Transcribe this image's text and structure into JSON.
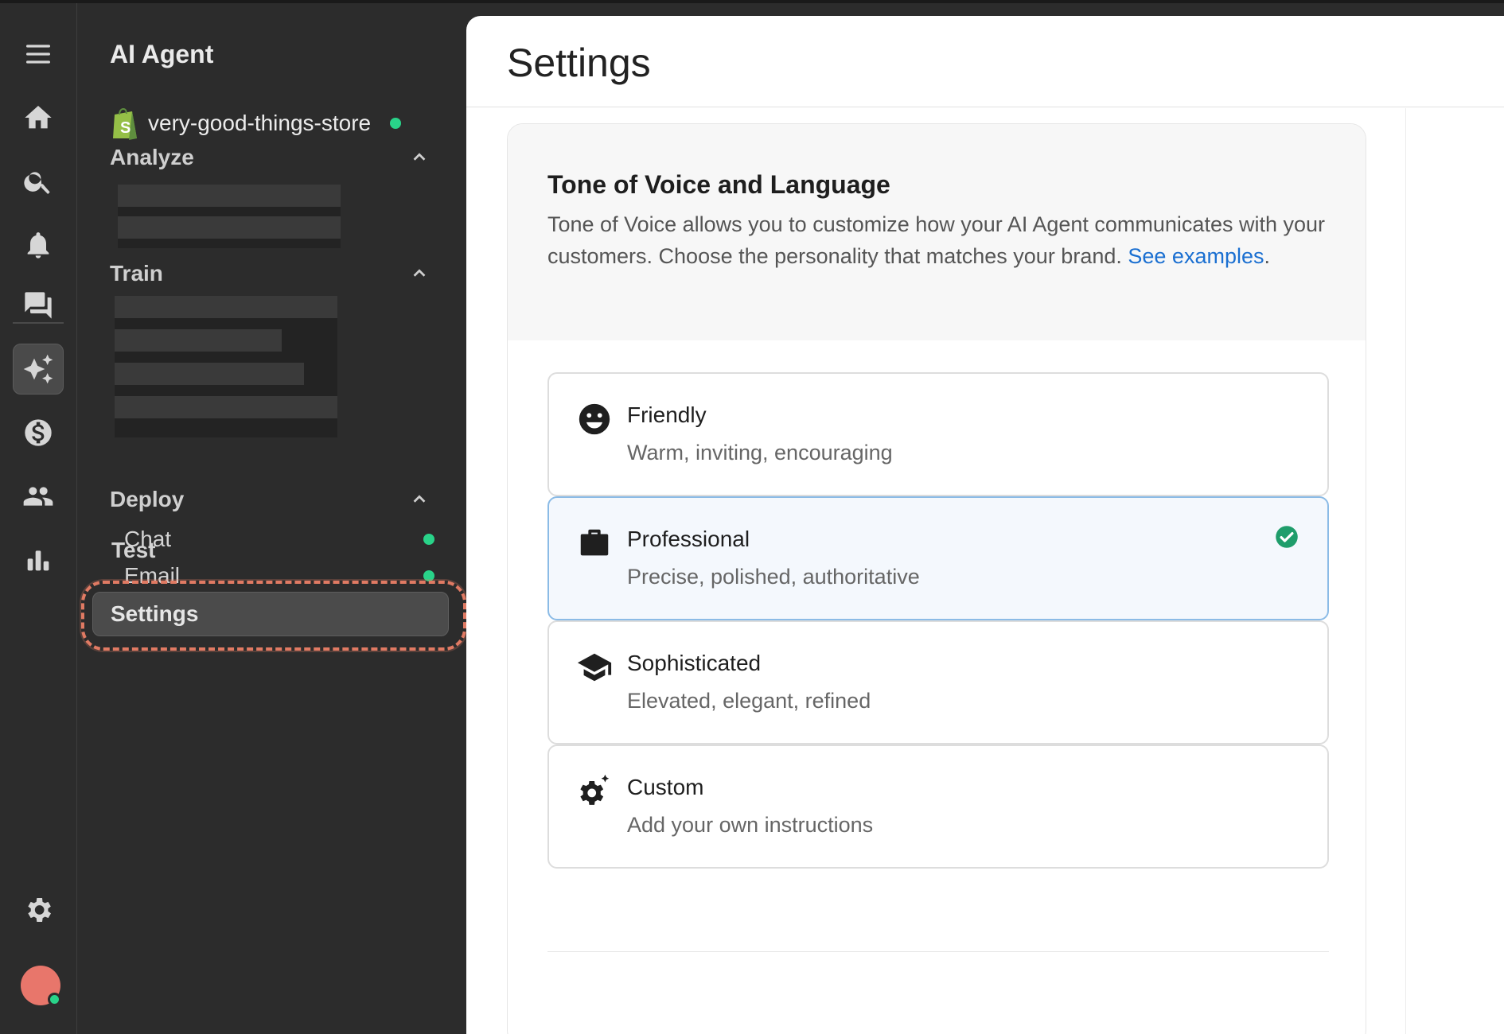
{
  "app": {
    "title": "AI Agent"
  },
  "store": {
    "name": "very-good-things-store",
    "status_color": "#29d389"
  },
  "rail": {
    "icons": [
      "menu-icon",
      "home-icon",
      "search-icon",
      "bell-icon",
      "chat-bubbles-icon",
      "sparkles-icon",
      "dollar-icon",
      "users-icon",
      "bar-chart-icon",
      "gear-icon"
    ],
    "active": "sparkles-icon"
  },
  "sidebar": {
    "analyze_label": "Analyze",
    "train_label": "Train",
    "test_label": "Test",
    "deploy_label": "Deploy",
    "deploy_items": [
      {
        "label": "Chat",
        "status_color": "#29d389"
      },
      {
        "label": "Email",
        "status_color": "#29d389"
      }
    ],
    "settings_label": "Settings"
  },
  "page": {
    "title": "Settings"
  },
  "tone": {
    "title": "Tone of Voice and Language",
    "description": "Tone of Voice allows you to customize how your AI Agent communicates with your customers. Choose the personality that matches your brand.",
    "link_text": "See examples",
    "link_suffix": ".",
    "options": [
      {
        "title": "Friendly",
        "subtitle": "Warm, inviting, encouraging",
        "icon": "smiley-icon",
        "selected": false
      },
      {
        "title": "Professional",
        "subtitle": "Precise, polished, authoritative",
        "icon": "briefcase-icon",
        "selected": true
      },
      {
        "title": "Sophisticated",
        "subtitle": "Elevated, elegant, refined",
        "icon": "graduation-cap-icon",
        "selected": false
      },
      {
        "title": "Custom",
        "subtitle": "Add your own instructions",
        "icon": "gear-sparkle-icon",
        "selected": false
      }
    ]
  },
  "colors": {
    "accent_link": "#1a6fd1",
    "highlight_ring": "#e07a63",
    "selected_check": "#1f9d6b"
  }
}
